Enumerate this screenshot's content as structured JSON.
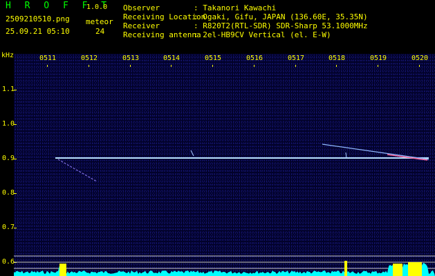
{
  "header": {
    "title": "H R O F F T",
    "version": "1.0.0",
    "file_name": "2509210510.png",
    "datetime": "25.09.21 05:10",
    "meteor_label": "meteor",
    "meteor_count": "24"
  },
  "info": {
    "observer_label": "Observer",
    "observer_value": ": Takanori Kawachi",
    "location_label": "Receiving Location",
    "location_value": ": Ogaki, Gifu, JAPAN (136.60E, 35.35N)",
    "receiver_label": "Receiver",
    "receiver_value": ": R820T2(RTL-SDR) SDR-Sharp 53.1000MHz",
    "antenna_label": "Receiving antenna",
    "antenna_value": ": 2el-HB9CV Vertical (el. E-W)"
  },
  "axes": {
    "unit": "kHz",
    "y_ticks": [
      "1.1",
      "1.0",
      "0.9",
      "0.8",
      "0.7",
      "0.6"
    ],
    "x_ticks": [
      "0511",
      "0512",
      "0513",
      "0514",
      "0515",
      "0516",
      "0517",
      "0518",
      "0519",
      "0520"
    ]
  },
  "colors": {
    "label": "#ffff00",
    "title": "#00ff00",
    "carrier": "#9fd8ff",
    "level": "#00ffff",
    "burst": "#ffff00"
  }
}
